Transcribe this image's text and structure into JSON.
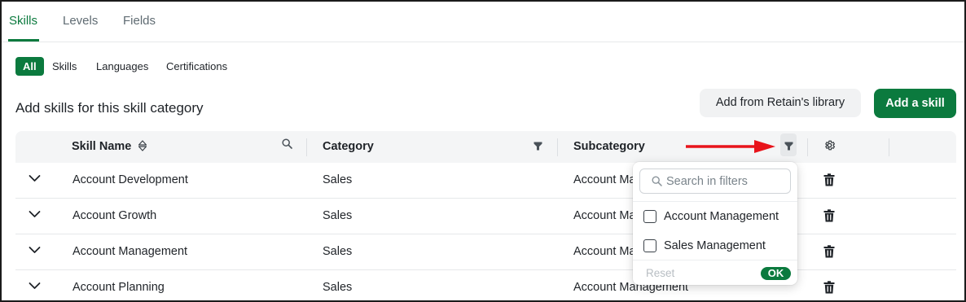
{
  "tabs": [
    {
      "label": "Skills",
      "active": true
    },
    {
      "label": "Levels",
      "active": false
    },
    {
      "label": "Fields",
      "active": false
    }
  ],
  "filters": [
    {
      "label": "All",
      "active": true
    },
    {
      "label": "Skills",
      "active": false
    },
    {
      "label": "Languages",
      "active": false
    },
    {
      "label": "Certifications",
      "active": false
    }
  ],
  "section_title": "Add skills for this skill category",
  "buttons": {
    "library": "Add from Retain's library",
    "add_skill": "Add a skill"
  },
  "table": {
    "columns": [
      "Skill Name",
      "Category",
      "Subcategory"
    ],
    "rows": [
      {
        "skill": "Account Development",
        "category": "Sales",
        "subcategory": "Account Management"
      },
      {
        "skill": "Account Growth",
        "category": "Sales",
        "subcategory": "Account Management"
      },
      {
        "skill": "Account Management",
        "category": "Sales",
        "subcategory": "Account Management"
      },
      {
        "skill": "Account Planning",
        "category": "Sales",
        "subcategory": "Account Management"
      }
    ]
  },
  "filter_dropdown": {
    "search_placeholder": "Search in filters",
    "options": [
      {
        "label": "Account Management",
        "checked": false
      },
      {
        "label": "Sales Management",
        "checked": false
      }
    ],
    "reset_label": "Reset",
    "ok_label": "OK"
  },
  "colors": {
    "brand": "#0b7a3e",
    "annotation_arrow": "#e8141b"
  }
}
